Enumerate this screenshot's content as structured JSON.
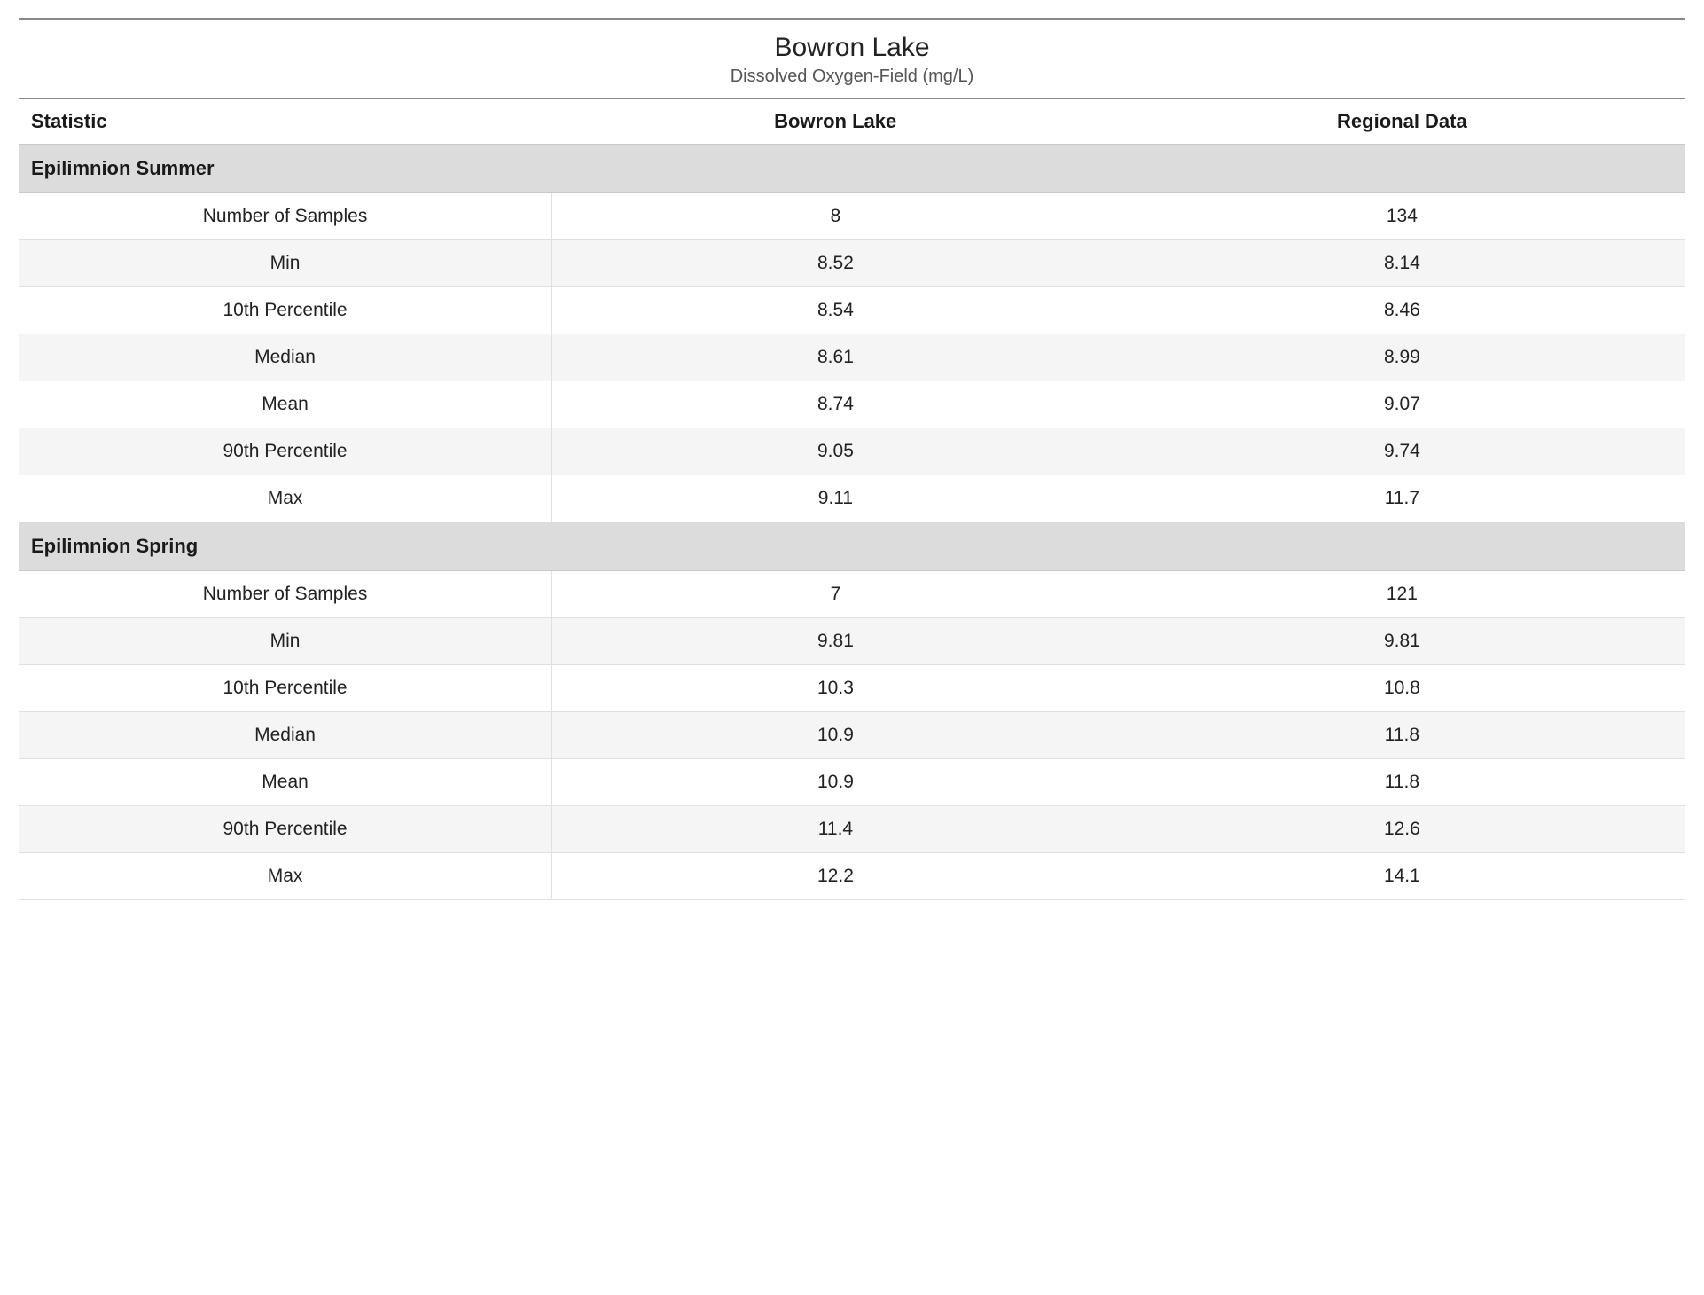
{
  "title": "Bowron Lake",
  "subtitle": "Dissolved Oxygen-Field (mg/L)",
  "columns": {
    "stat": "Statistic",
    "lake": "Bowron Lake",
    "regional": "Regional Data"
  },
  "sections": [
    {
      "name": "Epilimnion Summer",
      "rows": [
        {
          "stat": "Number of Samples",
          "lake": "8",
          "regional": "134"
        },
        {
          "stat": "Min",
          "lake": "8.52",
          "regional": "8.14"
        },
        {
          "stat": "10th Percentile",
          "lake": "8.54",
          "regional": "8.46"
        },
        {
          "stat": "Median",
          "lake": "8.61",
          "regional": "8.99"
        },
        {
          "stat": "Mean",
          "lake": "8.74",
          "regional": "9.07"
        },
        {
          "stat": "90th Percentile",
          "lake": "9.05",
          "regional": "9.74"
        },
        {
          "stat": "Max",
          "lake": "9.11",
          "regional": "11.7"
        }
      ]
    },
    {
      "name": "Epilimnion Spring",
      "rows": [
        {
          "stat": "Number of Samples",
          "lake": "7",
          "regional": "121"
        },
        {
          "stat": "Min",
          "lake": "9.81",
          "regional": "9.81"
        },
        {
          "stat": "10th Percentile",
          "lake": "10.3",
          "regional": "10.8"
        },
        {
          "stat": "Median",
          "lake": "10.9",
          "regional": "11.8"
        },
        {
          "stat": "Mean",
          "lake": "10.9",
          "regional": "11.8"
        },
        {
          "stat": "90th Percentile",
          "lake": "11.4",
          "regional": "12.6"
        },
        {
          "stat": "Max",
          "lake": "12.2",
          "regional": "14.1"
        }
      ]
    }
  ]
}
